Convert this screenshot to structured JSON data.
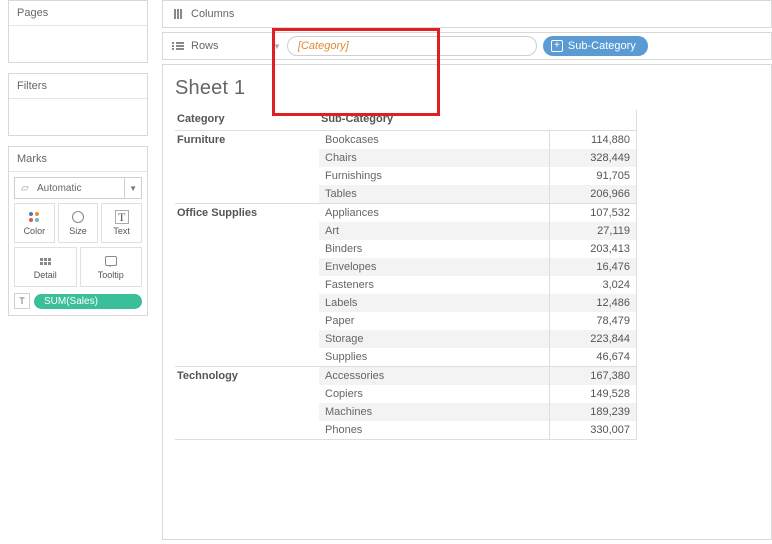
{
  "panels": {
    "pages": "Pages",
    "filters": "Filters",
    "marks": "Marks"
  },
  "marks": {
    "type_label": "Automatic",
    "cells": {
      "color": "Color",
      "size": "Size",
      "text": "Text",
      "detail": "Detail",
      "tooltip": "Tooltip"
    },
    "pill": "SUM(Sales)"
  },
  "shelves": {
    "columns_label": "Columns",
    "rows_label": "Rows",
    "rows_calc": "[Category]",
    "rows_pill": "Sub-Category"
  },
  "sheet": {
    "title": "Sheet 1",
    "headers": {
      "category": "Category",
      "subcategory": "Sub-Category"
    },
    "groups": [
      {
        "category": "Furniture",
        "rows": [
          {
            "sub": "Bookcases",
            "val": "114,880"
          },
          {
            "sub": "Chairs",
            "val": "328,449"
          },
          {
            "sub": "Furnishings",
            "val": "91,705"
          },
          {
            "sub": "Tables",
            "val": "206,966"
          }
        ]
      },
      {
        "category": "Office Supplies",
        "rows": [
          {
            "sub": "Appliances",
            "val": "107,532"
          },
          {
            "sub": "Art",
            "val": "27,119"
          },
          {
            "sub": "Binders",
            "val": "203,413"
          },
          {
            "sub": "Envelopes",
            "val": "16,476"
          },
          {
            "sub": "Fasteners",
            "val": "3,024"
          },
          {
            "sub": "Labels",
            "val": "12,486"
          },
          {
            "sub": "Paper",
            "val": "78,479"
          },
          {
            "sub": "Storage",
            "val": "223,844"
          },
          {
            "sub": "Supplies",
            "val": "46,674"
          }
        ]
      },
      {
        "category": "Technology",
        "rows": [
          {
            "sub": "Accessories",
            "val": "167,380"
          },
          {
            "sub": "Copiers",
            "val": "149,528"
          },
          {
            "sub": "Machines",
            "val": "189,239"
          },
          {
            "sub": "Phones",
            "val": "330,007"
          }
        ]
      }
    ]
  }
}
